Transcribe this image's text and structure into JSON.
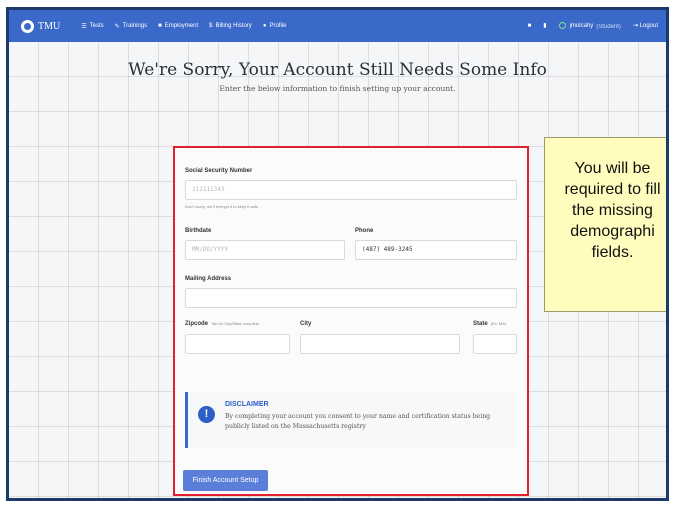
{
  "header": {
    "logo_text": "TMU",
    "nav": [
      {
        "icon": "list-icon",
        "glyph": "☰",
        "label": "Tests"
      },
      {
        "icon": "trainings-icon",
        "glyph": "✎",
        "label": "Trainings"
      },
      {
        "icon": "briefcase-icon",
        "glyph": "■",
        "label": "Employment"
      },
      {
        "icon": "dollar-icon",
        "glyph": "$",
        "label": "Billing History"
      },
      {
        "icon": "profile-icon",
        "glyph": "●",
        "label": "Profile"
      }
    ],
    "right": {
      "user_name": "jmulcahy",
      "user_role": "(Student)",
      "logout_label": "Logout"
    }
  },
  "page": {
    "title": "We're Sorry, Your Account Still Needs Some Info",
    "subtitle": "Enter the below information to finish setting up your account."
  },
  "form": {
    "ssn_label": "Social Security Number",
    "ssn_placeholder": "111111343",
    "ssn_help": "Don't worry, we'll encrypt it to keep it safe",
    "birthdate_label": "Birthdate",
    "birthdate_placeholder": "MM/DD/YYYY",
    "phone_label": "Phone",
    "phone_value": "(487) 489-3245",
    "mailing_label": "Mailing Address",
    "zip_label": "Zipcode",
    "zip_hint": "Tab for City/State complete",
    "city_label": "City",
    "state_label": "State",
    "state_hint": "(Ex: MA)"
  },
  "disclaimer": {
    "title": "DISCLAIMER",
    "text": "By completing your account you consent to your name and certification status being publicly listed on the Massachusetts registry"
  },
  "finish_button": "Finish Account Setup",
  "callout": {
    "text": "You will be\nrequired to fill\nthe missing\ndemographi\nfields."
  },
  "colors": {
    "nav_bg": "#3a69c9",
    "highlight_border": "#e0202c",
    "callout_bg": "#fffcbd",
    "button_bg": "#5b7fd8"
  }
}
